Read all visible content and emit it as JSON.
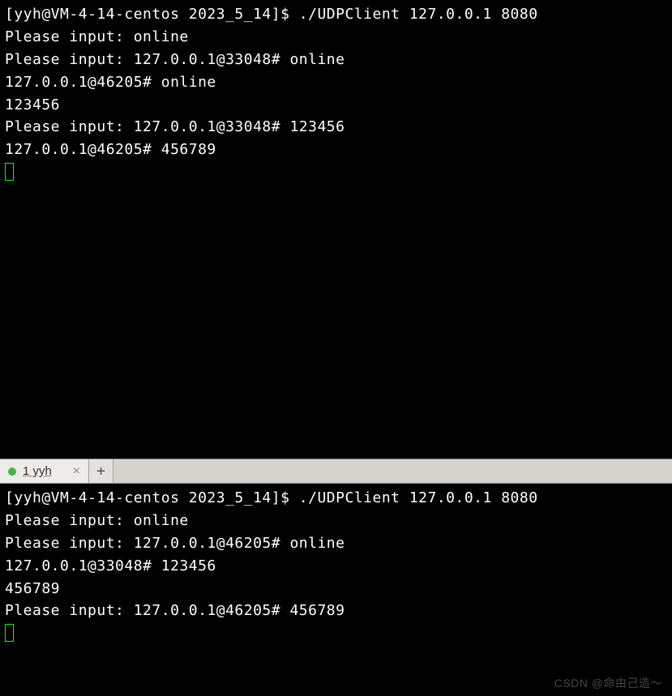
{
  "top": {
    "prompt": "[yyh@VM-4-14-centos 2023_5_14]$ ",
    "command": "./UDPClient 127.0.0.1 8080",
    "lines": [
      "Please input: online",
      "Please input: 127.0.0.1@33048# online",
      "127.0.0.1@46205# online",
      "123456",
      "Please input: 127.0.0.1@33048# 123456",
      "127.0.0.1@46205# 456789"
    ]
  },
  "tabbar": {
    "tab_label": "1 yyh",
    "close": "×",
    "plus": "+"
  },
  "bottom": {
    "prompt": "[yyh@VM-4-14-centos 2023_5_14]$ ",
    "command": "./UDPClient 127.0.0.1 8080",
    "lines": [
      "Please input: online",
      "Please input: 127.0.0.1@46205# online",
      "127.0.0.1@33048# 123456",
      "456789",
      "Please input: 127.0.0.1@46205# 456789"
    ]
  },
  "watermark": "CSDN @命由己造～"
}
